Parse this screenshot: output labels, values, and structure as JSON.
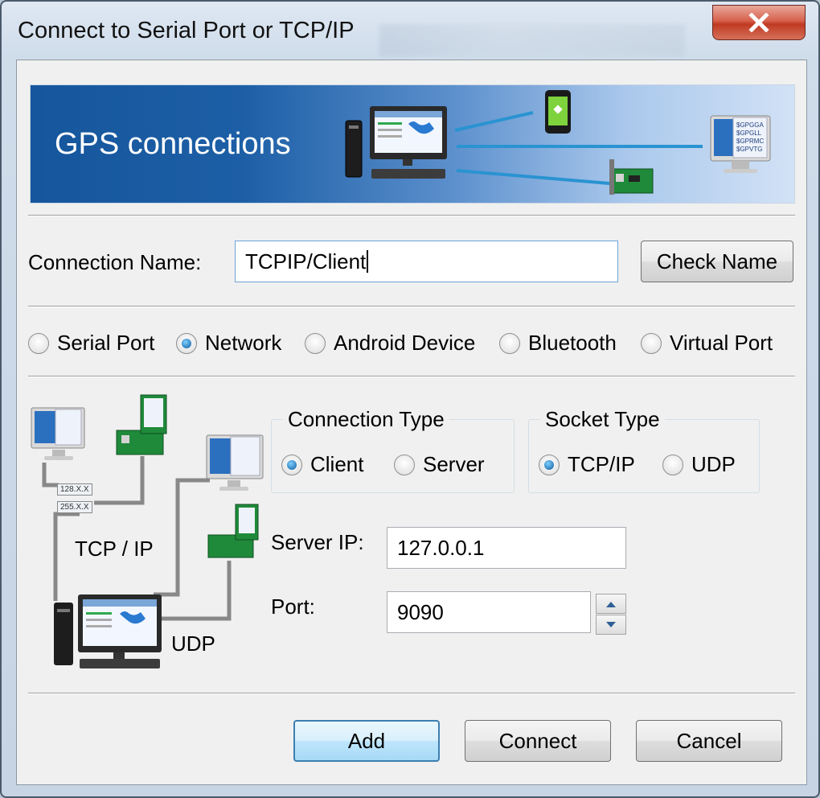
{
  "window": {
    "title": "Connect to Serial Port or TCP/IP"
  },
  "banner": {
    "title": "GPS connections",
    "monitor_lines": [
      "$GPGGA",
      "$GPGLL",
      "$GPRMC",
      "$GPVTG"
    ]
  },
  "connection_name": {
    "label": "Connection Name:",
    "value": "TCPIP/Client",
    "check_button": "Check Name"
  },
  "source_types": [
    {
      "label": "Serial Port",
      "selected": false
    },
    {
      "label": "Network",
      "selected": true
    },
    {
      "label": "Android Device",
      "selected": false
    },
    {
      "label": "Bluetooth",
      "selected": false
    },
    {
      "label": "Virtual Port",
      "selected": false
    }
  ],
  "diagram": {
    "tcp_label": "TCP / IP",
    "udp_label": "UDP",
    "ip_tags": [
      "128.X.X",
      "255.X.X"
    ]
  },
  "connection_type": {
    "title": "Connection Type",
    "options": [
      {
        "label": "Client",
        "selected": true
      },
      {
        "label": "Server",
        "selected": false
      }
    ]
  },
  "socket_type": {
    "title": "Socket Type",
    "options": [
      {
        "label": "TCP/IP",
        "selected": true
      },
      {
        "label": "UDP",
        "selected": false
      }
    ]
  },
  "server_ip": {
    "label": "Server IP:",
    "value": "127.0.0.1"
  },
  "port": {
    "label": "Port:",
    "value": "9090"
  },
  "buttons": {
    "add": "Add",
    "connect": "Connect",
    "cancel": "Cancel"
  }
}
